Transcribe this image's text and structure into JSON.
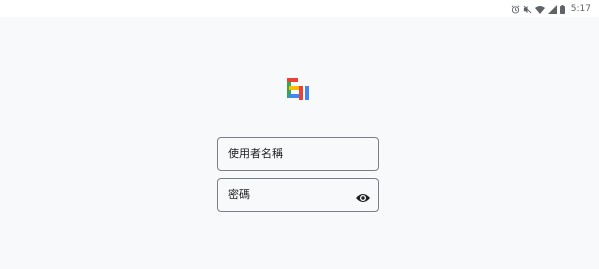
{
  "status_bar": {
    "time": "5:17",
    "icons": [
      "alarm-icon",
      "mute-icon",
      "wifi-icon",
      "signal-icon",
      "battery-icon"
    ]
  },
  "logo": {
    "name": "app-logo",
    "colors": [
      "#EA4335",
      "#FBBC05",
      "#34A853",
      "#4285F4"
    ]
  },
  "login_form": {
    "username_placeholder": "使用者名稱",
    "password_placeholder": "密碼",
    "password_visibility_icon": "eye-icon"
  }
}
